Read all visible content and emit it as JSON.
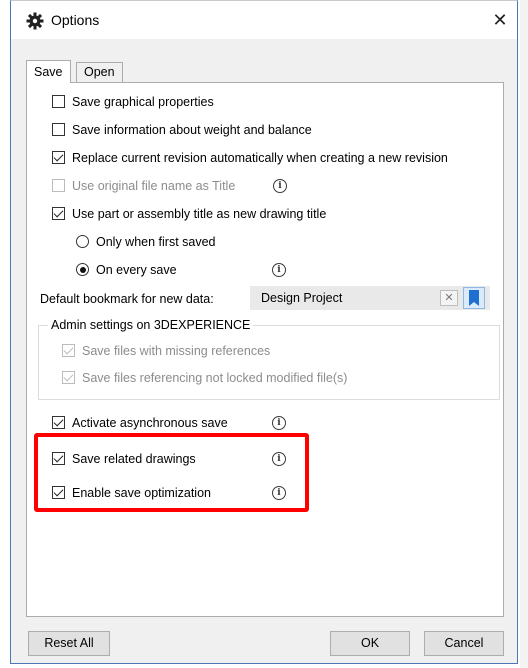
{
  "window": {
    "title": "Options",
    "close_glyph": "✕",
    "icon": "gear-icon"
  },
  "tabs": [
    {
      "label": "Save",
      "active": true
    },
    {
      "label": "Open",
      "active": false
    }
  ],
  "options": {
    "save_graphical": {
      "label": "Save graphical properties",
      "checked": false
    },
    "save_weight": {
      "label": "Save information about weight and balance",
      "checked": false
    },
    "replace_revision": {
      "label": "Replace current revision automatically when creating a new revision",
      "checked": true
    },
    "use_filename": {
      "label": "Use original file name as Title",
      "checked": false,
      "disabled": true
    },
    "use_part_title": {
      "label": "Use part or assembly title as new drawing title",
      "checked": true
    },
    "radio_first": {
      "label": "Only when first saved",
      "selected": false
    },
    "radio_every": {
      "label": "On every save",
      "selected": true
    },
    "async_save": {
      "label": "Activate asynchronous save",
      "checked": true
    },
    "save_related": {
      "label": "Save related drawings",
      "checked": true
    },
    "save_optimization": {
      "label": "Enable save optimization",
      "checked": true
    }
  },
  "bookmark": {
    "label": "Default bookmark for new data:",
    "value": "Design Project",
    "clear_glyph": "✕"
  },
  "admin": {
    "title": "Admin settings on 3DEXPERIENCE",
    "missing_refs": {
      "label": "Save files with missing references",
      "checked": true
    },
    "not_locked": {
      "label": "Save files referencing not locked modified file(s)",
      "checked": true
    }
  },
  "info_glyph": "i",
  "buttons": {
    "reset": "Reset All",
    "ok": "OK",
    "cancel": "Cancel"
  },
  "colors": {
    "highlight": "#ff0000",
    "bookmark_accent": "#1f6fd0"
  }
}
